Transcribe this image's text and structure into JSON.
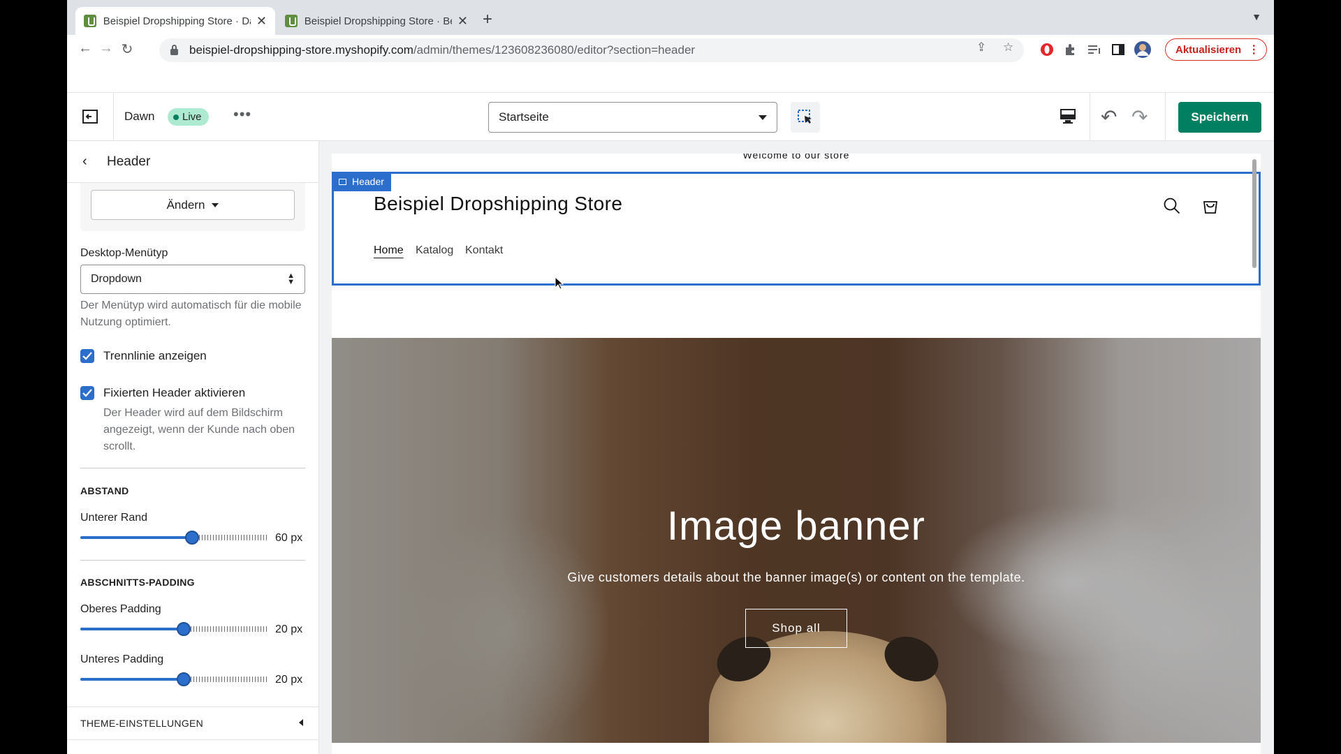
{
  "browser": {
    "tabs": [
      {
        "title": "Beispiel Dropshipping Store · Dawn · Shopify",
        "active": true
      },
      {
        "title": "Beispiel Dropshipping Store · Bearbeiten",
        "active": false
      }
    ],
    "url_host": "beispiel-dropshipping-store.myshopify.com",
    "url_path": "/admin/themes/123608236080/editor?section=header",
    "update_label": "Aktualisieren"
  },
  "editor": {
    "theme_name": "Dawn",
    "live_label": "Live",
    "page_select": "Startseite",
    "save_label": "Speichern"
  },
  "sidebar": {
    "title": "Header",
    "change_label": "Ändern",
    "menu_type_label": "Desktop-Menütyp",
    "menu_type_value": "Dropdown",
    "menu_type_help": "Der Menütyp wird automatisch für die mobile Nutzung optimiert.",
    "divider_label": "Trennlinie anzeigen",
    "divider_checked": true,
    "sticky_label": "Fixierten Header aktivieren",
    "sticky_checked": true,
    "sticky_help": "Der Header wird auf dem Bildschirm angezeigt, wenn der Kunde nach oben scrollt.",
    "spacing_heading": "ABSTAND",
    "bottom_margin_label": "Unterer Rand",
    "bottom_margin_value": "60 px",
    "bottom_margin_fraction": 0.6,
    "padding_heading": "ABSCHNITTS-PADDING",
    "top_padding_label": "Oberes Padding",
    "top_padding_value": "20 px",
    "top_padding_fraction": 0.55,
    "bottom_padding_label": "Unteres Padding",
    "bottom_padding_value": "20 px",
    "bottom_padding_fraction": 0.55,
    "theme_settings_label": "THEME-EINSTELLUNGEN"
  },
  "preview": {
    "announcement": "Welcome to our store",
    "header_tag": "Header",
    "store_name": "Beispiel Dropshipping Store",
    "nav": [
      "Home",
      "Katalog",
      "Kontakt"
    ],
    "banner_title": "Image banner",
    "banner_text": "Give customers details about the banner image(s) or content on the template.",
    "banner_button": "Shop all"
  },
  "colors": {
    "accent": "#2c6ecb",
    "save": "#008060",
    "live_badge": "#aee9d1"
  }
}
